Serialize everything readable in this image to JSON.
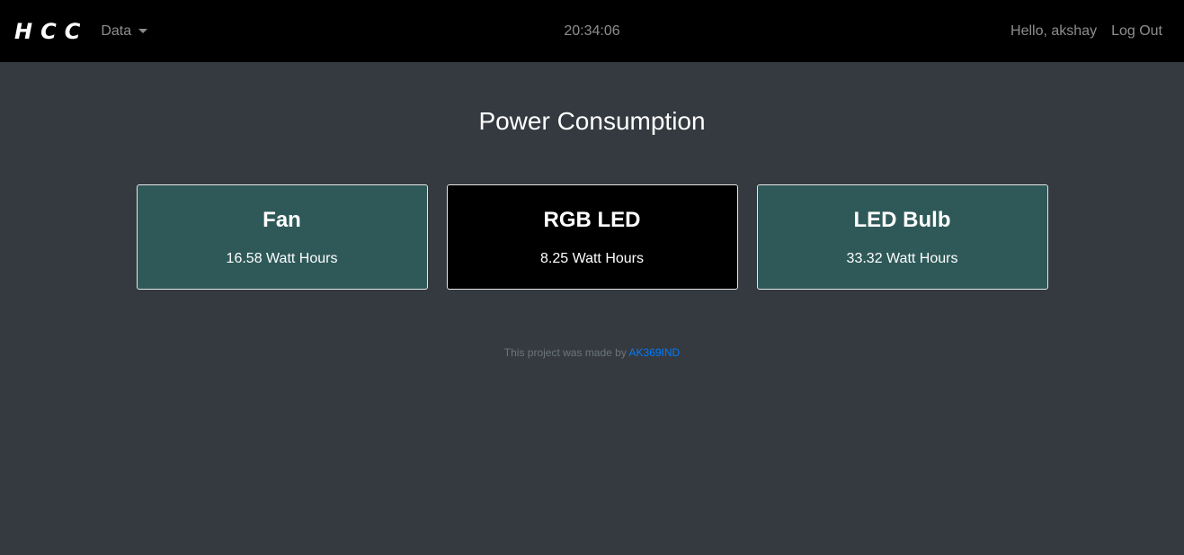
{
  "navbar": {
    "brand": "HCC",
    "data_menu_label": "Data",
    "clock": "20:34:06",
    "greeting": "Hello, akshay",
    "logout_label": "Log Out"
  },
  "main": {
    "title": "Power Consumption",
    "cards": [
      {
        "name": "Fan",
        "value": "16.58 Watt Hours",
        "background": "#2f5959"
      },
      {
        "name": "RGB LED",
        "value": "8.25 Watt Hours",
        "background": "#000000"
      },
      {
        "name": "LED Bulb",
        "value": "33.32 Watt Hours",
        "background": "#2f5959"
      }
    ]
  },
  "footer": {
    "text": "This project was made by",
    "link_text": "AK369IND"
  },
  "colors": {
    "navbar_bg": "#000000",
    "page_bg": "#343a40",
    "card_teal": "#2f5959",
    "link": "#007bff"
  }
}
